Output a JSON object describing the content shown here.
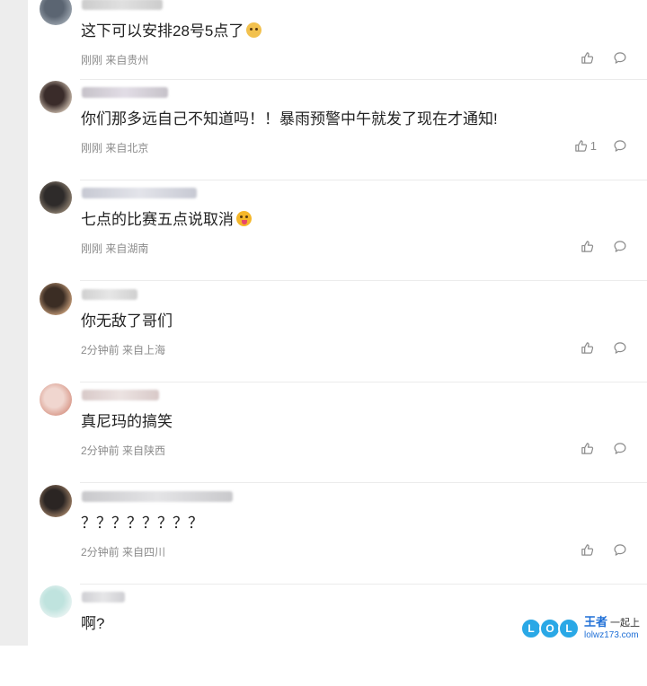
{
  "comments": [
    {
      "text": "这下可以安排28号5点了",
      "emoji": "cat-face",
      "meta": "刚刚 来自贵州",
      "like_count": "",
      "colors": {
        "avatar": [
          "#5b6572",
          "#9aa3ad"
        ],
        "name": [
          "#cccccc",
          "#e0e0e0"
        ]
      }
    },
    {
      "text": "你们那多远自己不知道吗！！暴雨预警中午就发了现在才通知!",
      "emoji": "",
      "meta": "刚刚 来自北京",
      "like_count": "1",
      "colors": {
        "avatar": [
          "#3a2c2a",
          "#c8b9aa"
        ],
        "name": [
          "#c6c2c9",
          "#e2dde6"
        ]
      }
    },
    {
      "text": "七点的比赛五点说取消",
      "emoji": "tongue-face",
      "meta": "刚刚 来自湖南",
      "like_count": "",
      "colors": {
        "avatar": [
          "#2e2b2a",
          "#8e8070"
        ],
        "name": [
          "#c7c9d3",
          "#e3e4ea"
        ]
      }
    },
    {
      "text": "你无敌了哥们",
      "emoji": "",
      "meta": "2分钟前 来自上海",
      "like_count": "",
      "colors": {
        "avatar": [
          "#3b2d24",
          "#c29a77"
        ],
        "name": [
          "#d0d0d0",
          "#e6e6e6"
        ]
      }
    },
    {
      "text": "真尼玛的搞笑",
      "emoji": "",
      "meta": "2分钟前 来自陕西",
      "like_count": "",
      "colors": {
        "avatar": [
          "#f0d6cf",
          "#d99a8b"
        ],
        "name": [
          "#d8c9c8",
          "#ece3e2"
        ]
      }
    },
    {
      "text": "？？？？？？？？",
      "emoji": "",
      "meta": "2分钟前 来自四川",
      "like_count": "",
      "colors": {
        "avatar": [
          "#2b2523",
          "#9a7c63"
        ],
        "name": [
          "#c9c9cc",
          "#e4e4e6"
        ]
      }
    },
    {
      "text": "啊?",
      "emoji": "",
      "meta": "",
      "like_count": "",
      "colors": {
        "avatar": [
          "#bfe3de",
          "#e8f3f2"
        ],
        "name": [
          "#cfcfd3",
          "#e6e6e8"
        ]
      }
    }
  ],
  "watermark": {
    "letters": [
      "L",
      "O",
      "L"
    ],
    "brand": "王者",
    "slogan": "一起上",
    "url": "lolwz173.com"
  }
}
